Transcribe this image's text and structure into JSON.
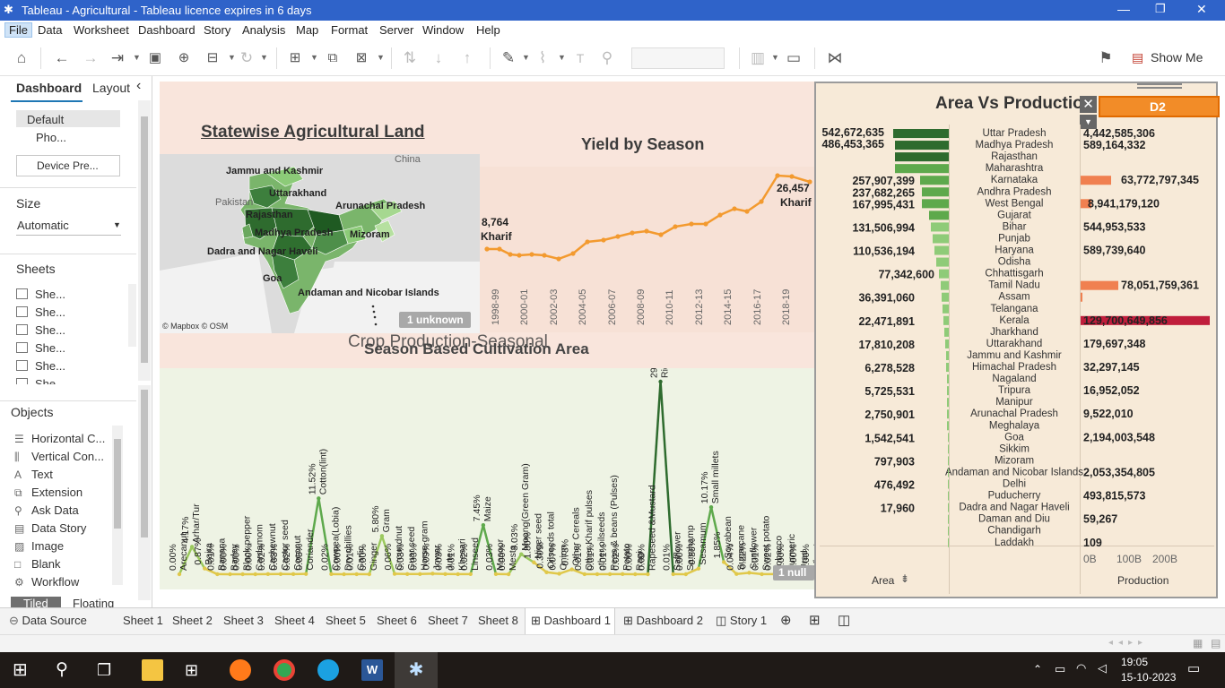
{
  "window": {
    "title": "Tableau - Agricultural - Tableau licence expires in 6 days"
  },
  "menu": [
    "File",
    "Data",
    "Worksheet",
    "Dashboard",
    "Story",
    "Analysis",
    "Map",
    "Format",
    "Server",
    "Window",
    "Help"
  ],
  "toolbar": {
    "show_me": "Show Me"
  },
  "left_panel": {
    "tab_dashboard": "Dashboard",
    "tab_layout": "Layout",
    "device_default": "Default",
    "device_phone": "Pho...",
    "device_preview": "Device Pre...",
    "size_heading": "Size",
    "size_value": "Automatic",
    "sheets_heading": "Sheets",
    "sheets": [
      "She...",
      "She...",
      "She...",
      "She...",
      "She...",
      "She..."
    ],
    "objects_heading": "Objects",
    "objects": [
      "Horizontal C...",
      "Vertical Con...",
      "Text",
      "Extension",
      "Ask Data",
      "Data Story",
      "Image",
      "Blank",
      "Workflow"
    ],
    "tiled": "Tiled",
    "floating": "Floating"
  },
  "dashboard": {
    "map_title": "Statewise Agricultural Land",
    "map_labels": [
      "Jammu and Kashmir",
      "Uttarakhand",
      "Rajasthan",
      "Arunachal Pradesh",
      "Madhya Pradesh",
      "Mizoram",
      "Dadra and Nagar Haveli",
      "Goa",
      "Andaman and Nicobar Islands",
      "China",
      "Pakistan"
    ],
    "map_attribution": "© Mapbox © OSM",
    "map_unknown": "1 unknown",
    "yield_title": "Yield by Season",
    "yield_years": [
      "1998-99",
      "2000-01",
      "2002-03",
      "2004-05",
      "2006-07",
      "2008-09",
      "2010-11",
      "2012-13",
      "2014-15",
      "2016-17",
      "2018-19"
    ],
    "yield_start_value": "8,764",
    "yield_start_label": "Kharif",
    "yield_end_value": "26,457",
    "yield_end_label": "Kharif",
    "crop_title": "Crop Production-Seasonal",
    "season_title": "Season Based Cultivation Area",
    "season_null": "1 null",
    "crop_labels": [
      {
        "crop": "Arecanut",
        "pct": "0.00%"
      },
      {
        "crop": "Arhar/Tur",
        "pct": "4.17%"
      },
      {
        "crop": "Bajra",
        "pct": "0.87%"
      },
      {
        "crop": "Banana",
        "pct": "0.01%"
      },
      {
        "crop": "Barley",
        "pct": "0.00%"
      },
      {
        "crop": "Black pepper",
        "pct": "0.00%"
      },
      {
        "crop": "Cardamom",
        "pct": "0.00%"
      },
      {
        "crop": "Cashewnut",
        "pct": "0.02%"
      },
      {
        "crop": "Castor seed",
        "pct": "0.03%"
      },
      {
        "crop": "Coconut",
        "pct": "0.02%"
      },
      {
        "crop": "Coriander",
        "pct": "0.05%"
      },
      {
        "crop": "Cotton(lint)",
        "pct": "11.52%"
      },
      {
        "crop": "Cowpea(Lobia)",
        "pct": "0.02%"
      },
      {
        "crop": "Dry chillies",
        "pct": "0.00%"
      },
      {
        "crop": "Garlic",
        "pct": "0.01%"
      },
      {
        "crop": "Ginger",
        "pct": "0.00%"
      },
      {
        "crop": "Gram",
        "pct": "5.80%"
      },
      {
        "crop": "Groundnut",
        "pct": "0.06%"
      },
      {
        "crop": "Guar seed",
        "pct": "0.03%"
      },
      {
        "crop": "Horse-gram",
        "pct": "0.03%"
      },
      {
        "crop": "Jowar",
        "pct": "0.09%"
      },
      {
        "crop": "Jute",
        "pct": "0.03%"
      },
      {
        "crop": "Khesari",
        "pct": "0.01%"
      },
      {
        "crop": "Linseed",
        "pct": "0.02%"
      },
      {
        "crop": "Maize",
        "pct": "7.45%"
      },
      {
        "crop": "Masoor",
        "pct": "0.03%"
      },
      {
        "crop": "Mesta",
        "pct": "0.00%"
      },
      {
        "crop": "Moong(Green Gram)",
        "pct": "3.03%"
      },
      {
        "crop": "Niger seed",
        "pct": "1.80%"
      },
      {
        "crop": "Oilseeds total",
        "pct": "0.30%"
      },
      {
        "crop": "Onion",
        "pct": "0.07%"
      },
      {
        "crop": "Other Cereals",
        "pct": "0.73%"
      },
      {
        "crop": "Other Kharif pulses",
        "pct": "0.01%"
      },
      {
        "crop": "other oilseeds",
        "pct": "0.01%"
      },
      {
        "crop": "Peas & beans (Pulses)",
        "pct": "0.01%"
      },
      {
        "crop": "Potato",
        "pct": "0.02%"
      },
      {
        "crop": "Ragi",
        "pct": "0.00%"
      },
      {
        "crop": "Rapeseed &Mustard",
        "pct": "0.00%"
      },
      {
        "crop": "Rice",
        "pct": "29.23%"
      },
      {
        "crop": "Safflower",
        "pct": "0.01%"
      },
      {
        "crop": "Sannhamp",
        "pct": "0.00%"
      },
      {
        "crop": "Sesamum",
        "pct": "0.86%"
      },
      {
        "crop": "Small millets",
        "pct": "10.17%"
      },
      {
        "crop": "Soyabean",
        "pct": "1.85%"
      },
      {
        "crop": "Sugarcane",
        "pct": "0.04%"
      },
      {
        "crop": "Sunflower",
        "pct": "0.22%"
      },
      {
        "crop": "Sweet potato",
        "pct": "0.01%"
      },
      {
        "crop": "Tobacco",
        "pct": "0.02%"
      },
      {
        "crop": "Turmeric",
        "pct": "0.00%"
      },
      {
        "crop": "Urad",
        "pct": "0.00%"
      },
      {
        "crop": "Wheat",
        "pct": "0.00%"
      }
    ],
    "area_title": "Area Vs Production",
    "area_sheet_badge": "D2",
    "area_axis_label": "Area",
    "prod_axis_label": "Production",
    "prod_ticks": [
      "0B",
      "100B",
      "200B"
    ],
    "states": [
      "Uttar Pradesh",
      "Madhya Pradesh",
      "Rajasthan",
      "Maharashtra",
      "Karnataka",
      "Andhra Pradesh",
      "West Bengal",
      "Gujarat",
      "Bihar",
      "Punjab",
      "Haryana",
      "Odisha",
      "Chhattisgarh",
      "Tamil Nadu",
      "Assam",
      "Telangana",
      "Kerala",
      "Jharkhand",
      "Uttarakhand",
      "Jammu and Kashmir",
      "Himachal Pradesh",
      "Nagaland",
      "Tripura",
      "Manipur",
      "Arunachal Pradesh",
      "Meghalaya",
      "Goa",
      "Sikkim",
      "Mizoram",
      "Andaman and Nicobar Islands",
      "Delhi",
      "Puducherry",
      "Dadra and Nagar Haveli",
      "Daman and Diu",
      "Chandigarh",
      "Laddakh"
    ],
    "area_labels": [
      "542,672,635",
      "486,453,365",
      "257,907,399",
      "237,682,265",
      "167,995,431",
      "131,506,994",
      "110,536,194",
      "77,342,600",
      "36,391,060",
      "22,471,891",
      "17,810,208",
      "6,278,528",
      "5,725,531",
      "2,750,901",
      "1,542,541",
      "797,903",
      "476,492",
      "17,960"
    ],
    "prod_labels": [
      "4,442,585,306",
      "589,164,332",
      "63,772,797,345",
      "8,941,179,120",
      "544,953,533",
      "589,739,640",
      "78,051,759,361",
      "129,700,649,856",
      "179,697,348",
      "32,297,145",
      "16,952,052",
      "9,522,010",
      "2,194,003,548",
      "2,053,354,805",
      "493,815,573",
      "59,267",
      "109"
    ]
  },
  "tabs": [
    "Data Source",
    "Sheet 1",
    "Sheet 2",
    "Sheet 3",
    "Sheet 4",
    "Sheet 5",
    "Sheet 6",
    "Sheet 7",
    "Sheet 8",
    "Dashboard 1",
    "Dashboard 2",
    "Story 1"
  ],
  "clock": {
    "time": "19:05",
    "date": "15-10-2023"
  },
  "colors": {
    "titlebar": "#2f63c9",
    "dark_green": "#2e6b2e",
    "orange": "#f39a2f",
    "red": "#c01e3c",
    "panel_pink": "#f9e5dc",
    "panel_green": "#eef3e4"
  }
}
